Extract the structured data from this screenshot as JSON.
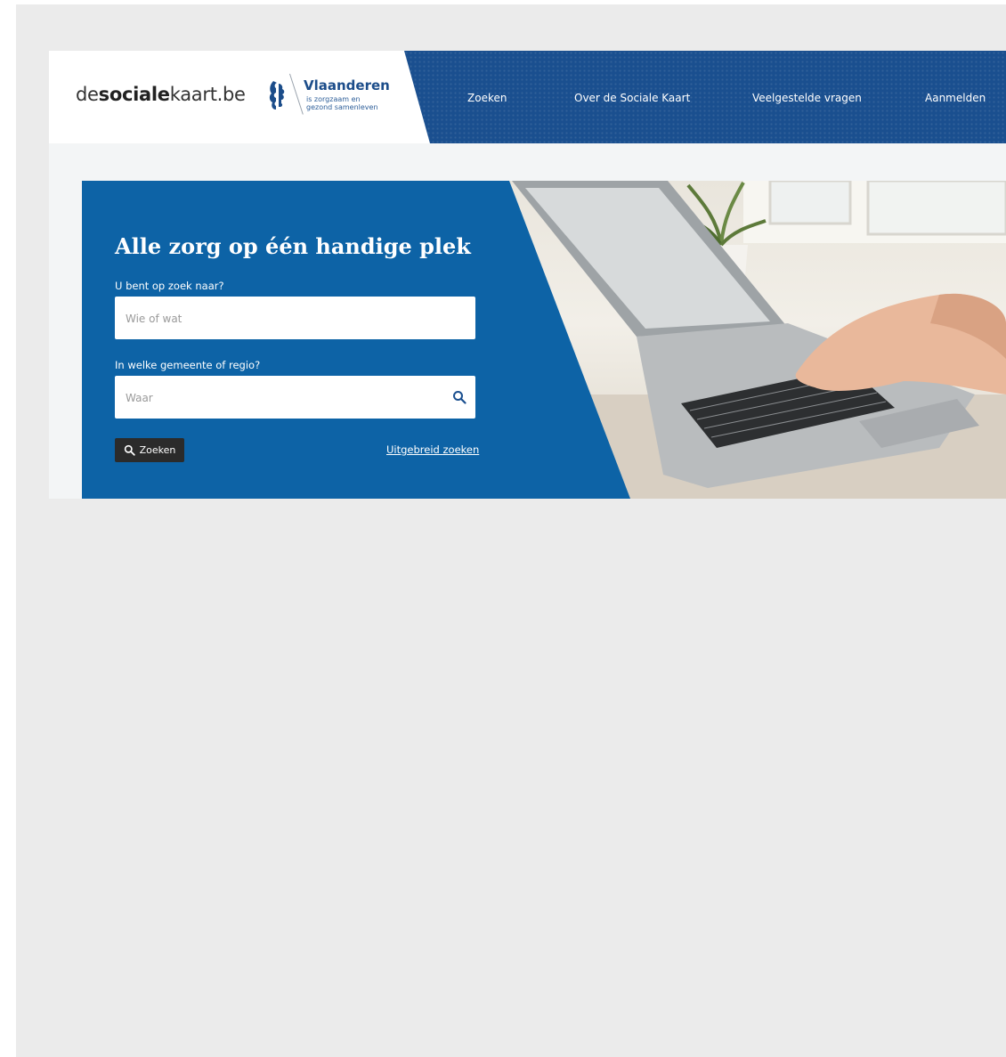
{
  "brand": {
    "part1": "de",
    "part2": "sociale",
    "part3": "kaart.be"
  },
  "vlaanderen": {
    "title": "Vlaanderen",
    "subtitle_line1": "is zorgzaam en",
    "subtitle_line2": "gezond samenleven"
  },
  "nav": {
    "items": [
      {
        "label": "Zoeken"
      },
      {
        "label": "Over de Sociale Kaart"
      },
      {
        "label": "Veelgestelde vragen"
      },
      {
        "label": "Aanmelden"
      }
    ]
  },
  "hero": {
    "title": "Alle zorg op één handige plek",
    "what_label": "U bent op zoek naar?",
    "what_placeholder": "Wie of wat",
    "where_label": "In welke gemeente of regio?",
    "where_placeholder": "Waar",
    "search_button": "Zoeken",
    "advanced_link": "Uitgebreid zoeken"
  },
  "colors": {
    "nav_background": "#1a4f8f",
    "hero_panel": "#0d63a6",
    "search_button": "#2b2b2b",
    "page_background": "#ebebeb"
  }
}
